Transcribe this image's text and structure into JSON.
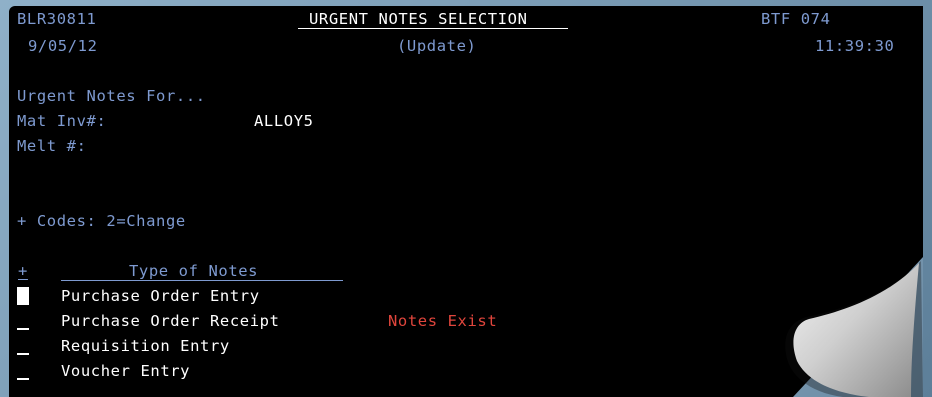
{
  "header": {
    "program_id": "BLR30811",
    "title": "URGENT NOTES SELECTION",
    "device_id": "BTF 074",
    "date": "9/05/12",
    "mode": "(Update)",
    "time": "11:39:30"
  },
  "context": {
    "heading": "Urgent Notes For...",
    "mat_inv_label": "Mat Inv#:",
    "mat_inv_value": "ALLOY5",
    "melt_label": "Melt #:"
  },
  "legend": {
    "codes": "+ Codes: 2=Change"
  },
  "list": {
    "opt_header": "+",
    "type_header": "Type of Notes",
    "rows": [
      {
        "type": "Purchase Order Entry",
        "status": ""
      },
      {
        "type": "Purchase Order Receipt",
        "status": "Notes Exist"
      },
      {
        "type": "Requisition Entry",
        "status": ""
      },
      {
        "type": "Voucher Entry",
        "status": ""
      }
    ]
  },
  "colors": {
    "label_blue": "#7e9ad0",
    "value_white": "#ffffff",
    "alert_red": "#e0453c",
    "background": "#000000"
  }
}
